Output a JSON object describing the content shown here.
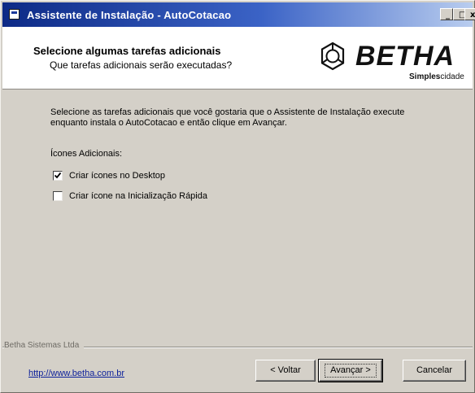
{
  "window": {
    "title": "Assistente de Instalação - AutoCotacao",
    "controls": {
      "minimize": "_",
      "maximize": "□",
      "close": "x"
    }
  },
  "header": {
    "title": "Selecione algumas tarefas adicionais",
    "subtitle": "Que tarefas adicionais serão executadas?",
    "logo": {
      "brand": "BETHA",
      "tagline_bold": "Simples",
      "tagline_rest": "cidade"
    }
  },
  "content": {
    "instruction": "Selecione as tarefas adicionais que você gostaria que o Assistente de Instalação execute enquanto instala o AutoCotacao e então clique em Avançar.",
    "group_label": "Ícones Adicionais:",
    "tasks": [
      {
        "label": "Criar ícones no Desktop",
        "checked": true
      },
      {
        "label": "Criar ícone na Inicialização Rápida",
        "checked": false
      }
    ]
  },
  "footer": {
    "company": "Betha Sistemas Ltda",
    "link": "http://www.betha.com.br",
    "buttons": {
      "back": "< Voltar",
      "next": "Avançar >",
      "cancel": "Cancelar"
    }
  },
  "colors": {
    "titlebar_start": "#0d2a86",
    "titlebar_end": "#b9cdef",
    "face": "#d4d0c8",
    "link": "#0b1f9a"
  }
}
